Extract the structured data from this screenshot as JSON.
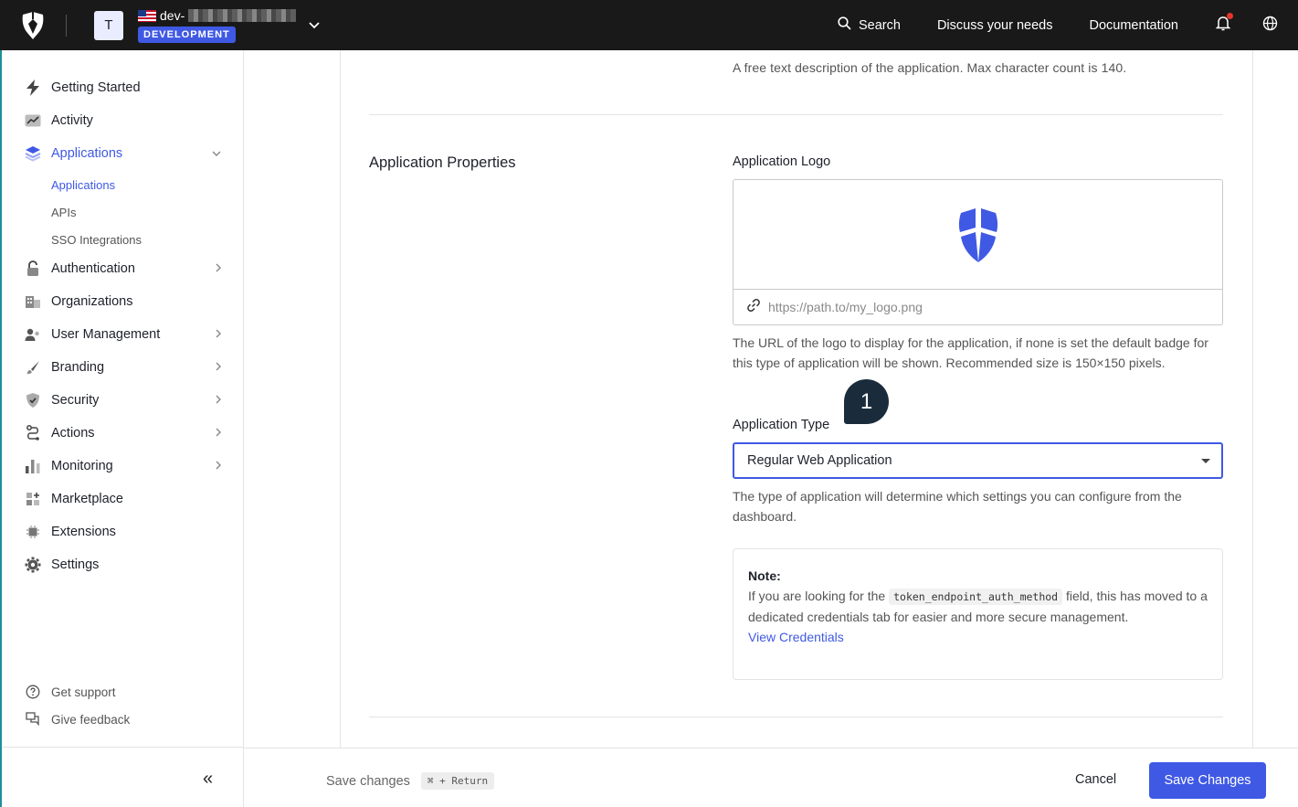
{
  "topbar": {
    "tenant_initial": "T",
    "tenant_name_prefix": "dev-",
    "env_badge": "DEVELOPMENT",
    "search_label": "Search",
    "discuss_label": "Discuss your needs",
    "docs_label": "Documentation"
  },
  "sidebar": {
    "items": [
      {
        "label": "Getting Started"
      },
      {
        "label": "Activity"
      },
      {
        "label": "Applications"
      },
      {
        "label": "Authentication"
      },
      {
        "label": "Organizations"
      },
      {
        "label": "User Management"
      },
      {
        "label": "Branding"
      },
      {
        "label": "Security"
      },
      {
        "label": "Actions"
      },
      {
        "label": "Monitoring"
      },
      {
        "label": "Marketplace"
      },
      {
        "label": "Extensions"
      },
      {
        "label": "Settings"
      }
    ],
    "sub_items": [
      {
        "label": "Applications"
      },
      {
        "label": "APIs"
      },
      {
        "label": "SSO Integrations"
      }
    ],
    "footer": {
      "support": "Get support",
      "feedback": "Give feedback",
      "collapse": "«"
    }
  },
  "main": {
    "description_help": "A free text description of the application. Max character count is 140.",
    "section_title": "Application Properties",
    "logo_label": "Application Logo",
    "logo_placeholder": "https://path.to/my_logo.png",
    "logo_help": "The URL of the logo to display for the application, if none is set the default badge for this type of application will be shown. Recommended size is 150×150 pixels.",
    "type_label": "Application Type",
    "type_value": "Regular Web Application",
    "type_help": "The type of application will determine which settings you can configure from the dashboard.",
    "note": {
      "title": "Note:",
      "text_before": "If you are looking for the ",
      "code": "token_endpoint_auth_method",
      "text_after": " field, this has moved to a dedicated credentials tab for easier and more secure management.",
      "link": "View Credentials"
    },
    "step_bubble": "1"
  },
  "bottombar": {
    "hint": "Save changes",
    "shortcut": "⌘ + Return",
    "cancel": "Cancel",
    "save": "Save Changes"
  },
  "colors": {
    "accent": "#3f59e4",
    "topbar": "#191919",
    "bubble": "#1a2c3b"
  }
}
